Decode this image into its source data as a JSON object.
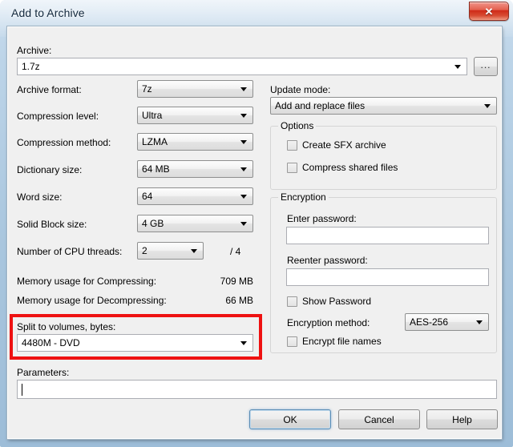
{
  "window": {
    "title": "Add to Archive",
    "close_glyph": "✕",
    "close_icon_name": "close-icon"
  },
  "archive": {
    "label": "Archive:",
    "value": "1.7z",
    "browse_label": "..."
  },
  "left_column": {
    "archive_format": {
      "label": "Archive format:",
      "value": "7z"
    },
    "compression_level": {
      "label": "Compression level:",
      "value": "Ultra"
    },
    "compression_method": {
      "label": "Compression method:",
      "value": "LZMA"
    },
    "dictionary_size": {
      "label": "Dictionary size:",
      "value": "64 MB"
    },
    "word_size": {
      "label": "Word size:",
      "value": "64"
    },
    "solid_block_size": {
      "label": "Solid Block size:",
      "value": "4 GB"
    },
    "cpu_threads": {
      "label": "Number of CPU threads:",
      "value": "2",
      "suffix": "/ 4"
    },
    "memory_compressing": {
      "label": "Memory usage for Compressing:",
      "value": "709 MB"
    },
    "memory_decompressing": {
      "label": "Memory usage for Decompressing:",
      "value": "66 MB"
    },
    "split_to_volumes": {
      "label": "Split to volumes, bytes:",
      "value": "4480M - DVD"
    },
    "parameters": {
      "label": "Parameters:",
      "value": ""
    }
  },
  "right_column": {
    "update_mode": {
      "label": "Update mode:",
      "value": "Add and replace files"
    },
    "options": {
      "title": "Options",
      "create_sfx": {
        "label": "Create SFX archive",
        "checked": false
      },
      "compress_shared": {
        "label": "Compress shared files",
        "checked": false
      }
    },
    "encryption": {
      "title": "Encryption",
      "enter_password": {
        "label": "Enter password:",
        "value": ""
      },
      "reenter_password": {
        "label": "Reenter password:",
        "value": ""
      },
      "show_password": {
        "label": "Show Password",
        "checked": false
      },
      "encryption_method": {
        "label": "Encryption method:",
        "value": "AES-256"
      },
      "encrypt_file_names": {
        "label": "Encrypt file names",
        "checked": false
      }
    }
  },
  "buttons": {
    "ok": "OK",
    "cancel": "Cancel",
    "help": "Help"
  },
  "annotation": {
    "color": "#ee1111",
    "target": "split-to-volumes-group"
  }
}
